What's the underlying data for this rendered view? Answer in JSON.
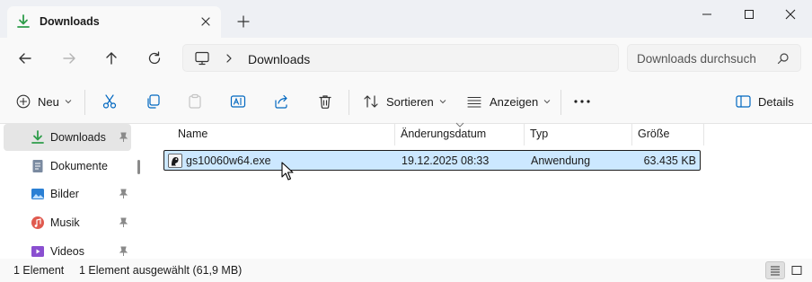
{
  "window": {
    "tab_title": "Downloads",
    "new_tab_symbol": "+",
    "controls": [
      "minimize",
      "maximize",
      "close"
    ]
  },
  "address": {
    "breadcrumb": "Downloads",
    "search_placeholder": "Downloads durchsuch"
  },
  "toolbar": {
    "new_label": "Neu",
    "sort_label": "Sortieren",
    "view_label": "Anzeigen",
    "more_label": "...",
    "details_label": "Details"
  },
  "sidebar": {
    "items": [
      {
        "label": "Downloads",
        "icon": "download-icon",
        "color": "#2e9d4a",
        "pinned": true
      },
      {
        "label": "Dokumente",
        "icon": "document-icon",
        "color": "#7a8aa0",
        "pinned": true
      },
      {
        "label": "Bilder",
        "icon": "image-icon",
        "color": "#2a7fd4",
        "pinned": true
      },
      {
        "label": "Musik",
        "icon": "music-icon",
        "color": "#e05a4f",
        "pinned": true
      },
      {
        "label": "Videos",
        "icon": "video-icon",
        "color": "#8a4fd0",
        "pinned": true
      }
    ]
  },
  "filelist": {
    "columns": [
      "Name",
      "Änderungsdatum",
      "Typ",
      "Größe"
    ],
    "rows": [
      {
        "name": "gs10060w64.exe",
        "date": "19.12.2025 08:33",
        "type": "Anwendung",
        "size": "63.435 KB",
        "selected": true
      }
    ]
  },
  "status": {
    "count": "1 Element",
    "selection": "1 Element ausgewählt (61,9 MB)"
  },
  "colors": {
    "accent": "#0067c0",
    "selection": "#cce8ff",
    "download_green": "#2e9d4a"
  }
}
